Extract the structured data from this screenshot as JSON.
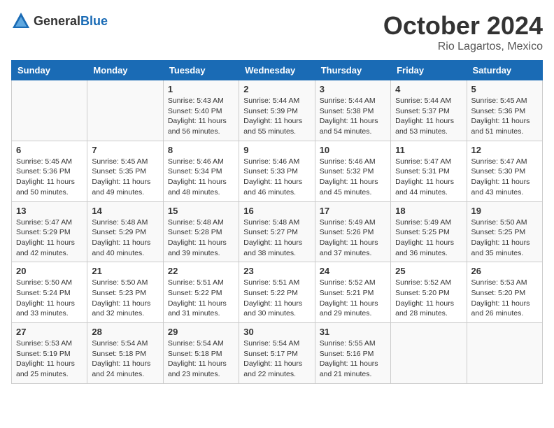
{
  "header": {
    "logo_general": "General",
    "logo_blue": "Blue",
    "month": "October 2024",
    "location": "Rio Lagartos, Mexico"
  },
  "weekdays": [
    "Sunday",
    "Monday",
    "Tuesday",
    "Wednesday",
    "Thursday",
    "Friday",
    "Saturday"
  ],
  "weeks": [
    [
      {
        "day": "",
        "info": ""
      },
      {
        "day": "",
        "info": ""
      },
      {
        "day": "1",
        "info": "Sunrise: 5:43 AM\nSunset: 5:40 PM\nDaylight: 11 hours and 56 minutes."
      },
      {
        "day": "2",
        "info": "Sunrise: 5:44 AM\nSunset: 5:39 PM\nDaylight: 11 hours and 55 minutes."
      },
      {
        "day": "3",
        "info": "Sunrise: 5:44 AM\nSunset: 5:38 PM\nDaylight: 11 hours and 54 minutes."
      },
      {
        "day": "4",
        "info": "Sunrise: 5:44 AM\nSunset: 5:37 PM\nDaylight: 11 hours and 53 minutes."
      },
      {
        "day": "5",
        "info": "Sunrise: 5:45 AM\nSunset: 5:36 PM\nDaylight: 11 hours and 51 minutes."
      }
    ],
    [
      {
        "day": "6",
        "info": "Sunrise: 5:45 AM\nSunset: 5:36 PM\nDaylight: 11 hours and 50 minutes."
      },
      {
        "day": "7",
        "info": "Sunrise: 5:45 AM\nSunset: 5:35 PM\nDaylight: 11 hours and 49 minutes."
      },
      {
        "day": "8",
        "info": "Sunrise: 5:46 AM\nSunset: 5:34 PM\nDaylight: 11 hours and 48 minutes."
      },
      {
        "day": "9",
        "info": "Sunrise: 5:46 AM\nSunset: 5:33 PM\nDaylight: 11 hours and 46 minutes."
      },
      {
        "day": "10",
        "info": "Sunrise: 5:46 AM\nSunset: 5:32 PM\nDaylight: 11 hours and 45 minutes."
      },
      {
        "day": "11",
        "info": "Sunrise: 5:47 AM\nSunset: 5:31 PM\nDaylight: 11 hours and 44 minutes."
      },
      {
        "day": "12",
        "info": "Sunrise: 5:47 AM\nSunset: 5:30 PM\nDaylight: 11 hours and 43 minutes."
      }
    ],
    [
      {
        "day": "13",
        "info": "Sunrise: 5:47 AM\nSunset: 5:29 PM\nDaylight: 11 hours and 42 minutes."
      },
      {
        "day": "14",
        "info": "Sunrise: 5:48 AM\nSunset: 5:29 PM\nDaylight: 11 hours and 40 minutes."
      },
      {
        "day": "15",
        "info": "Sunrise: 5:48 AM\nSunset: 5:28 PM\nDaylight: 11 hours and 39 minutes."
      },
      {
        "day": "16",
        "info": "Sunrise: 5:48 AM\nSunset: 5:27 PM\nDaylight: 11 hours and 38 minutes."
      },
      {
        "day": "17",
        "info": "Sunrise: 5:49 AM\nSunset: 5:26 PM\nDaylight: 11 hours and 37 minutes."
      },
      {
        "day": "18",
        "info": "Sunrise: 5:49 AM\nSunset: 5:25 PM\nDaylight: 11 hours and 36 minutes."
      },
      {
        "day": "19",
        "info": "Sunrise: 5:50 AM\nSunset: 5:25 PM\nDaylight: 11 hours and 35 minutes."
      }
    ],
    [
      {
        "day": "20",
        "info": "Sunrise: 5:50 AM\nSunset: 5:24 PM\nDaylight: 11 hours and 33 minutes."
      },
      {
        "day": "21",
        "info": "Sunrise: 5:50 AM\nSunset: 5:23 PM\nDaylight: 11 hours and 32 minutes."
      },
      {
        "day": "22",
        "info": "Sunrise: 5:51 AM\nSunset: 5:22 PM\nDaylight: 11 hours and 31 minutes."
      },
      {
        "day": "23",
        "info": "Sunrise: 5:51 AM\nSunset: 5:22 PM\nDaylight: 11 hours and 30 minutes."
      },
      {
        "day": "24",
        "info": "Sunrise: 5:52 AM\nSunset: 5:21 PM\nDaylight: 11 hours and 29 minutes."
      },
      {
        "day": "25",
        "info": "Sunrise: 5:52 AM\nSunset: 5:20 PM\nDaylight: 11 hours and 28 minutes."
      },
      {
        "day": "26",
        "info": "Sunrise: 5:53 AM\nSunset: 5:20 PM\nDaylight: 11 hours and 26 minutes."
      }
    ],
    [
      {
        "day": "27",
        "info": "Sunrise: 5:53 AM\nSunset: 5:19 PM\nDaylight: 11 hours and 25 minutes."
      },
      {
        "day": "28",
        "info": "Sunrise: 5:54 AM\nSunset: 5:18 PM\nDaylight: 11 hours and 24 minutes."
      },
      {
        "day": "29",
        "info": "Sunrise: 5:54 AM\nSunset: 5:18 PM\nDaylight: 11 hours and 23 minutes."
      },
      {
        "day": "30",
        "info": "Sunrise: 5:54 AM\nSunset: 5:17 PM\nDaylight: 11 hours and 22 minutes."
      },
      {
        "day": "31",
        "info": "Sunrise: 5:55 AM\nSunset: 5:16 PM\nDaylight: 11 hours and 21 minutes."
      },
      {
        "day": "",
        "info": ""
      },
      {
        "day": "",
        "info": ""
      }
    ]
  ]
}
